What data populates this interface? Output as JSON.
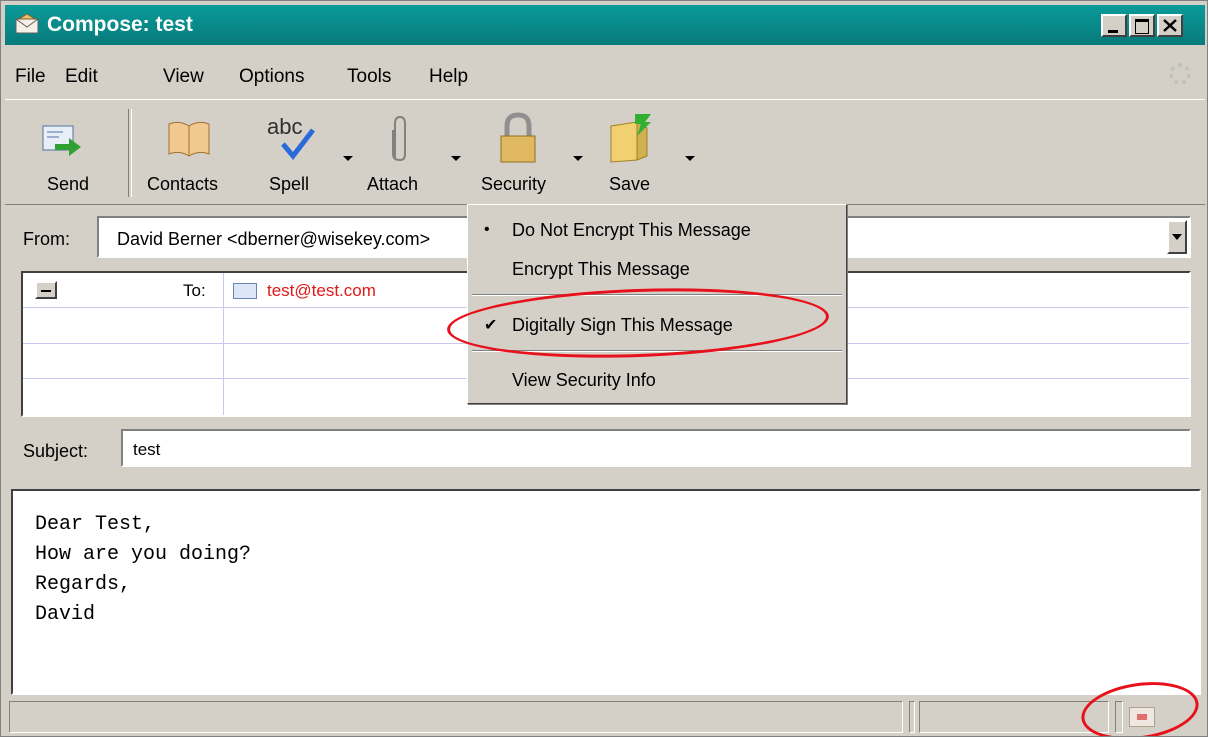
{
  "window": {
    "title": "Compose: test",
    "controls": {
      "minimize": "_",
      "maximize": "□",
      "close": "×"
    }
  },
  "menu": {
    "items": [
      "File",
      "Edit",
      "View",
      "Options",
      "Tools",
      "Help"
    ]
  },
  "toolbar": {
    "send": "Send",
    "contacts": "Contacts",
    "spell": "Spell",
    "spell_glyph": "abc",
    "attach": "Attach",
    "security": "Security",
    "save": "Save"
  },
  "from": {
    "label": "From:",
    "value": "David Berner <dberner@wisekey.com>"
  },
  "recipients": {
    "type_label": "To:",
    "address": "test@test.com"
  },
  "subject": {
    "label": "Subject:",
    "value": "test"
  },
  "body": {
    "lines": [
      "Dear Test,",
      "How are you doing?",
      "Regards,",
      "David"
    ]
  },
  "security_menu": {
    "items": [
      {
        "label": "Do Not Encrypt This Message",
        "mark": "•"
      },
      {
        "label": "Encrypt This Message",
        "mark": ""
      },
      {
        "label": "Digitally Sign This Message",
        "mark": "✔"
      },
      {
        "label": "View Security Info",
        "mark": ""
      }
    ]
  },
  "colors": {
    "titlebar": "#0a9a9a",
    "window_bg": "#d4d0c8",
    "recipient_text": "#e01818",
    "annotation": "#e8101a"
  },
  "icons": [
    "envelope-icon",
    "send-icon",
    "contacts-book-icon",
    "spellcheck-icon",
    "paperclip-icon",
    "padlock-icon",
    "save-folder-icon",
    "throbber-icon",
    "address-card-icon",
    "signed-message-status-icon"
  ]
}
